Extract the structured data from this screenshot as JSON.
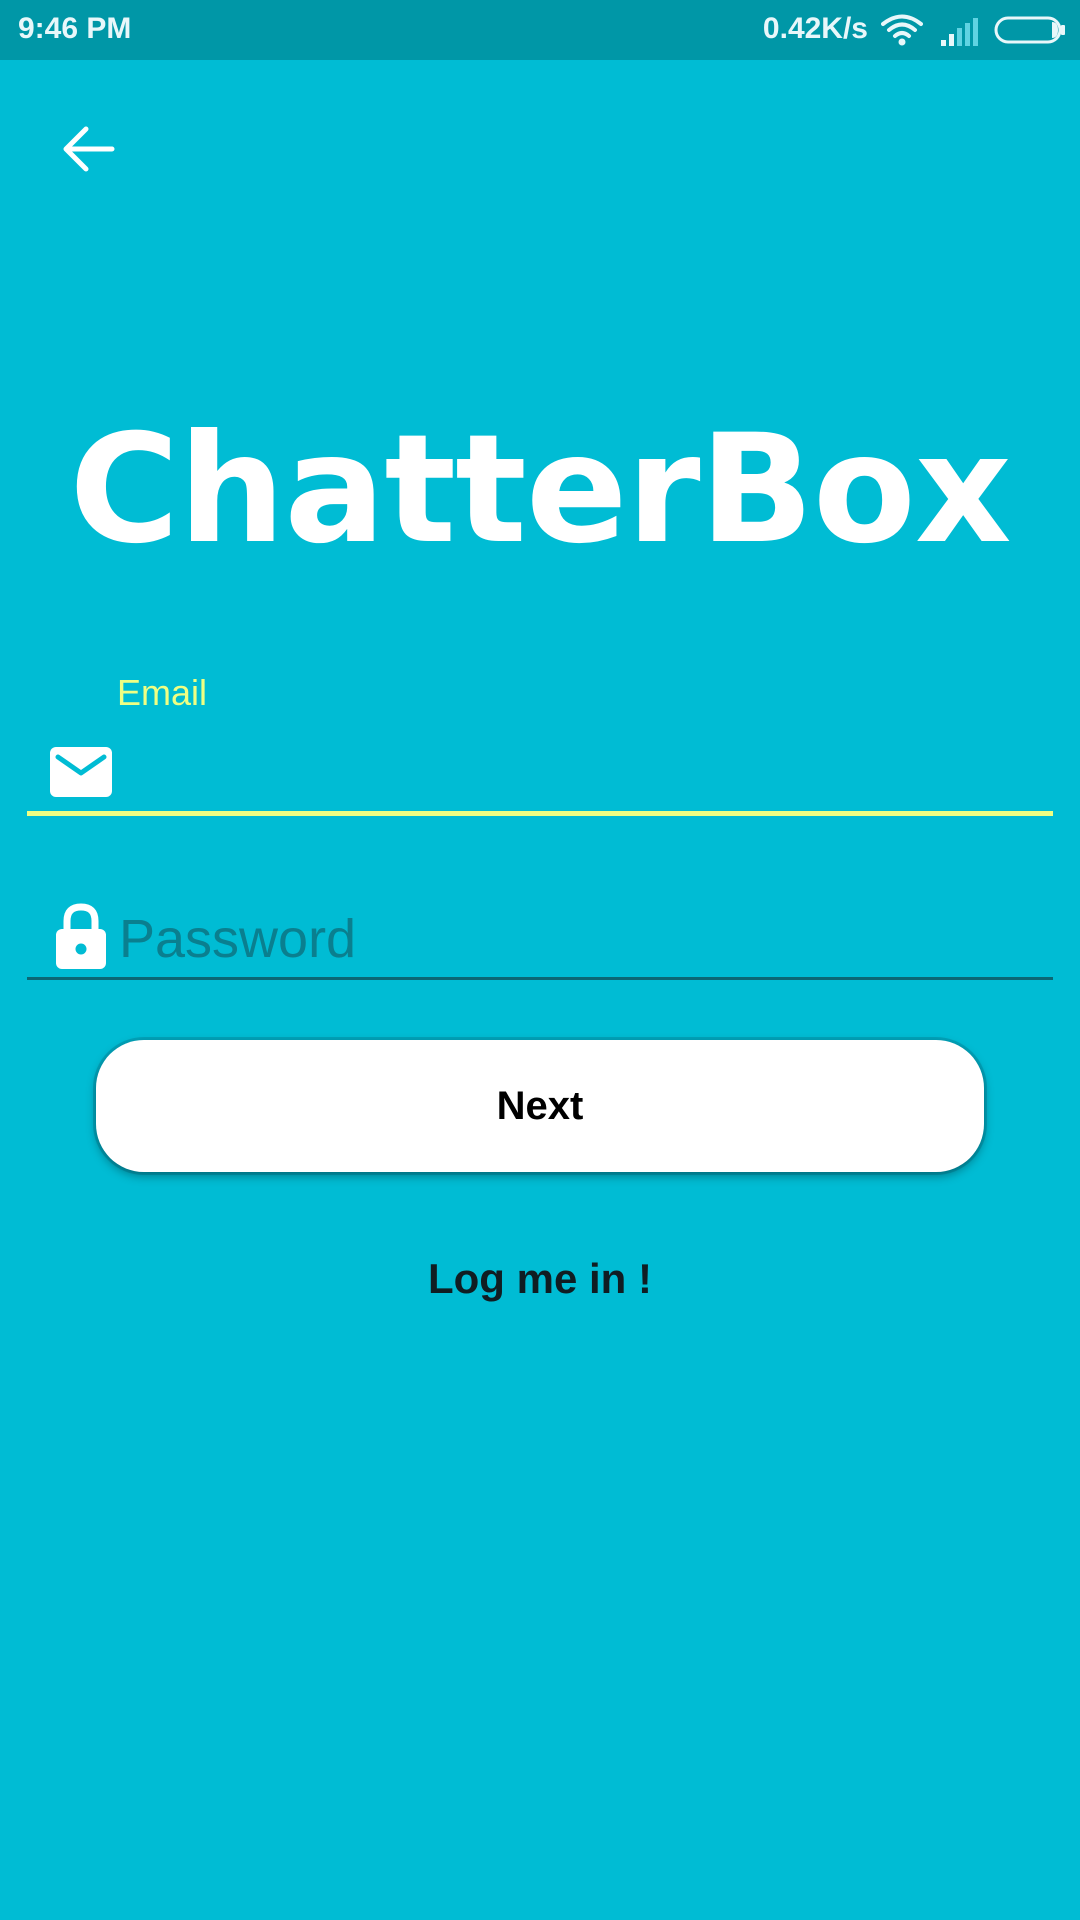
{
  "status_bar": {
    "time": "9:46 PM",
    "network_speed": "0.42K/s",
    "icons": [
      "wifi-icon",
      "signal-icon",
      "battery-icon"
    ]
  },
  "nav": {
    "back_icon": "arrow-left-icon"
  },
  "app": {
    "title": "ChatterBox"
  },
  "form": {
    "email": {
      "label": "Email",
      "value": "",
      "icon": "envelope-icon"
    },
    "password": {
      "placeholder": "Password",
      "value": "",
      "icon": "lock-icon"
    },
    "next_label": "Next",
    "login_link": "Log me in !"
  },
  "colors": {
    "background": "#00bcd4",
    "status_bar": "#0097a7",
    "accent": "#eeff83",
    "button_bg": "#ffffff",
    "password_placeholder": "#0a7f8f"
  }
}
